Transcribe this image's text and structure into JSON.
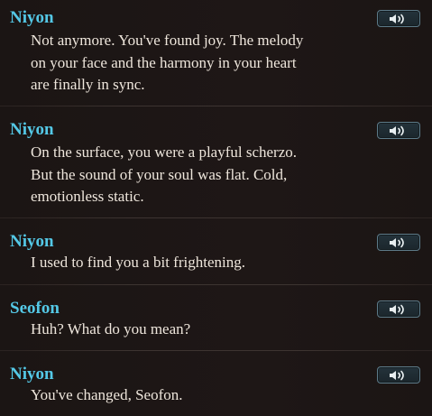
{
  "dialogue_log": [
    {
      "speaker": "Niyon",
      "lines": [
        "Not anymore. You've found joy. The melody",
        "on your face and the harmony in your heart",
        "are finally in sync."
      ],
      "voice_icon": "speaker-icon"
    },
    {
      "speaker": "Niyon",
      "lines": [
        "On the surface, you were a playful scherzo.",
        "But the sound of your soul was flat. Cold,",
        "emotionless static."
      ],
      "voice_icon": "speaker-icon"
    },
    {
      "speaker": "Niyon",
      "lines": [
        "I used to find you a bit frightening."
      ],
      "voice_icon": "speaker-icon"
    },
    {
      "speaker": "Seofon",
      "lines": [
        "Huh? What do you mean?"
      ],
      "voice_icon": "speaker-icon"
    },
    {
      "speaker": "Niyon",
      "lines": [
        "You've changed, Seofon."
      ],
      "voice_icon": "speaker-icon"
    }
  ],
  "colors": {
    "speaker_name": "#54c8e6",
    "dialogue_text": "#eee6dc",
    "background": "#1b1514",
    "button_border": "#5d7a88"
  }
}
